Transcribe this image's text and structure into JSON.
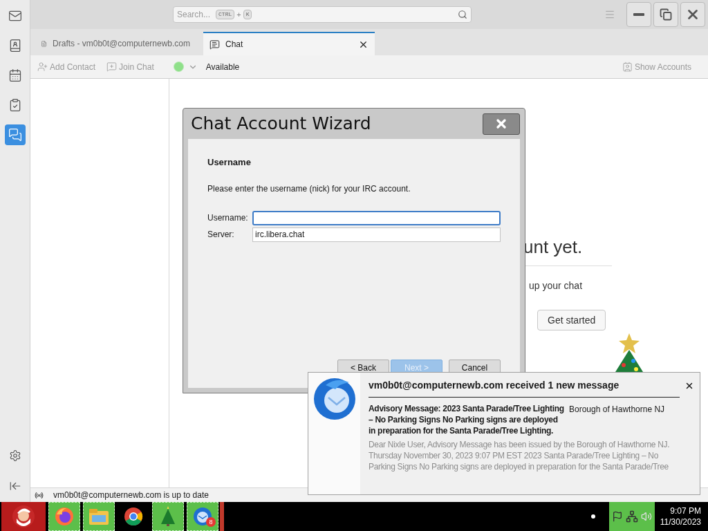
{
  "spaces_bar": {
    "items": [
      {
        "kind": "mail",
        "selected": false
      },
      {
        "kind": "contacts",
        "selected": false
      },
      {
        "kind": "calendar",
        "selected": false
      },
      {
        "kind": "tasks",
        "selected": false
      },
      {
        "kind": "chat",
        "selected": true
      }
    ]
  },
  "search": {
    "placeholder": "Search...",
    "shortcut": [
      "CTRL",
      "+",
      "K"
    ]
  },
  "tabs": [
    {
      "kind": "drafts",
      "label": "Drafts - vm0b0t@computernewb.com",
      "selected": false
    },
    {
      "kind": "chat",
      "label": "Chat",
      "selected": true
    }
  ],
  "toolbar": {
    "add_contact": "Add Contact",
    "join_chat": "Join Chat",
    "status": "Available",
    "show_accounts": "Show Accounts"
  },
  "main": {
    "heading": "unt yet.",
    "text": "up your chat",
    "button": "Get started"
  },
  "status_bar": "vm0b0t@computernewb.com is up to date",
  "dialog": {
    "title": "Chat Account Wizard",
    "heading": "Username",
    "description": "Please enter the username (nick) for your IRC account.",
    "fields": [
      {
        "label": "Username:",
        "focused": true
      },
      {
        "label": "Server:",
        "value": "irc.libera.chat",
        "focused": false
      }
    ],
    "buttons": [
      {
        "label": "< Back",
        "default": false
      },
      {
        "label": "Next >",
        "default": true
      },
      {
        "label": "Cancel",
        "default": false
      }
    ]
  },
  "notification": {
    "title": "vm0b0t@computernewb.com received 1 new message",
    "subject": "Advisory Message: 2023 Santa Parade/Tree Lighting – No Parking Signs No Parking signs are deployed in preparation for the Santa Parade/Tree Lighting.",
    "sender": "Borough of Hawthorne NJ",
    "preview": "Dear Nixle User, Advisory Message has been issued by the Borough of Hawthorne NJ. Thursday November 30, 2023 9:07 PM EST 2023 Santa Parade/Tree Lighting – No Parking Signs No Parking signs are deployed in preparation for the Santa Parade/Tree"
  },
  "taskbar": {
    "apps": [
      {
        "kind": "start",
        "highlighted": false
      },
      {
        "kind": "firefox",
        "highlighted": true
      },
      {
        "kind": "explorer",
        "highlighted": true
      },
      {
        "kind": "chrome",
        "highlighted": false
      },
      {
        "kind": "tree",
        "highlighted": true
      },
      {
        "kind": "thunderbird",
        "highlighted": true,
        "badge": "8"
      }
    ],
    "clock": {
      "time": "9:07 PM",
      "date": "11/30/2023"
    }
  }
}
